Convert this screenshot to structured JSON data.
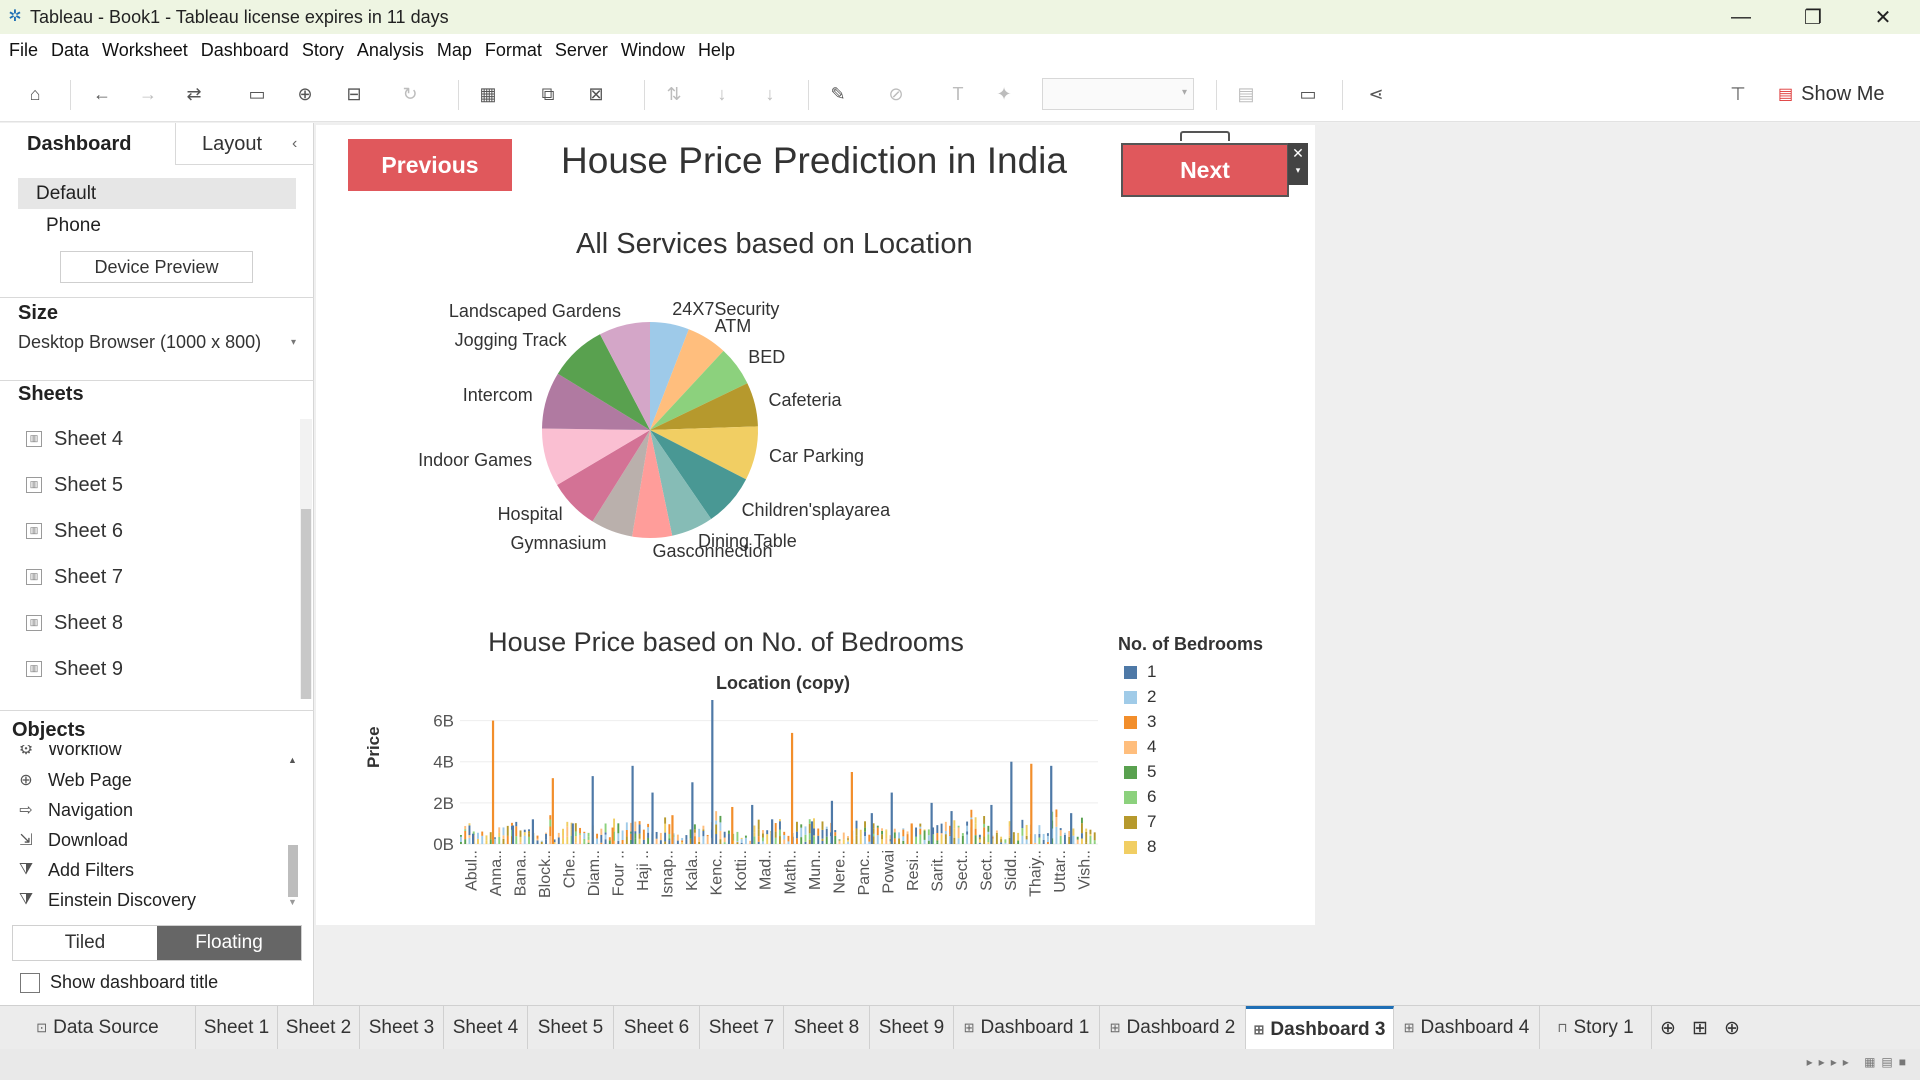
{
  "window": {
    "title": "Tableau - Book1 - Tableau license expires in 11 days",
    "controls": {
      "minimize": "—",
      "maximize": "❐",
      "close": "✕"
    }
  },
  "menu": [
    "File",
    "Data",
    "Worksheet",
    "Dashboard",
    "Story",
    "Analysis",
    "Map",
    "Format",
    "Server",
    "Window",
    "Help"
  ],
  "toolbar": {
    "show_me": "Show Me"
  },
  "left_panel": {
    "tabs": {
      "dashboard": "Dashboard",
      "layout": "Layout"
    },
    "device": {
      "default": "Default",
      "phone": "Phone",
      "preview_button": "Device Preview"
    },
    "size": {
      "title": "Size",
      "value": "Desktop Browser (1000 x 800)"
    },
    "sheets": {
      "title": "Sheets",
      "items": [
        "Sheet 4",
        "Sheet 5",
        "Sheet 6",
        "Sheet 7",
        "Sheet 8",
        "Sheet 9"
      ]
    },
    "objects": {
      "title": "Objects",
      "items": [
        "Workflow",
        "Web Page",
        "Navigation",
        "Download",
        "Add Filters",
        "Einstein Discovery"
      ]
    },
    "layout_mode": {
      "tiled": "Tiled",
      "floating": "Floating"
    },
    "show_title": "Show dashboard title"
  },
  "dashboard": {
    "title": "House Price Prediction in India",
    "prev_button": "Previous",
    "next_button": "Next",
    "next_close": "✕",
    "next_menu": "▾"
  },
  "chart_data": [
    {
      "type": "pie",
      "title": "All Services based on Location",
      "categories": [
        "24X7Security",
        "ATM",
        "BED",
        "Cafeteria",
        "Car Parking",
        "Children'splayarea",
        "Dining Table",
        "Gasconnection",
        "Gymnasium",
        "Hospital",
        "Indoor Games",
        "Intercom",
        "Jogging Track",
        "Landscaped Gardens"
      ],
      "values": [
        5.5,
        5.7,
        5.6,
        6.2,
        7.6,
        7.4,
        5.9,
        5.6,
        5.9,
        7.1,
        8.2,
        8.0,
        8.1,
        7.2
      ],
      "colors": [
        "#9ecae9",
        "#ffbe7d",
        "#8cd17d",
        "#b6992d",
        "#f1ce63",
        "#499894",
        "#86bcb6",
        "#ff9d9a",
        "#bab0ac",
        "#d37295",
        "#fabfd2",
        "#b07aa1",
        "#59a14f",
        "#d4a6c8",
        "#9d7660",
        "#a0785c",
        "#d7b5a6"
      ]
    },
    {
      "type": "bar",
      "title": "House Price based on  No. of Bedrooms",
      "top_label": "Location (copy)",
      "ylabel": "Price",
      "ylim": [
        0,
        7
      ],
      "y_ticks": [
        "6B",
        "4B",
        "2B",
        "0B"
      ],
      "y_tick_values": [
        6,
        4,
        2,
        0
      ],
      "x_tick_labels": [
        "Abul..",
        "Anna..",
        "Bana..",
        "Block..",
        "Che..",
        "Diam..",
        "Four ..",
        "Haji ..",
        "Isnap..",
        "Kala..",
        "Kenc..",
        "Kotti..",
        "Mad..",
        "Math..",
        "Mun..",
        "Nere..",
        "Panc..",
        "Powai",
        "Resi..",
        "Sarit..",
        "Sect..",
        "Sect..",
        "Sidd..",
        "Thaiy..",
        "Uttar..",
        "Vish.."
      ],
      "legend_title": "No. of Bedrooms",
      "series": [
        {
          "name": "1",
          "color": "#4e79a7"
        },
        {
          "name": "2",
          "color": "#a0cbe8"
        },
        {
          "name": "3",
          "color": "#f28e2b"
        },
        {
          "name": "4",
          "color": "#ffbe7d"
        },
        {
          "name": "5",
          "color": "#59a14f"
        },
        {
          "name": "6",
          "color": "#8cd17d"
        },
        {
          "name": "7",
          "color": "#b6992d"
        },
        {
          "name": "8",
          "color": "#f1ce63"
        }
      ],
      "highlight_bars_billions": [
        0.5,
        6.0,
        0.9,
        1.2,
        3.2,
        1.0,
        3.3,
        0.8,
        3.8,
        2.5,
        1.4,
        3.0,
        7.0,
        1.8,
        1.9,
        1.2,
        5.4,
        1.1,
        2.1,
        3.5,
        1.5,
        2.5,
        1.0,
        2.0,
        1.6,
        1.2,
        1.9,
        4.0,
        3.9,
        3.8,
        1.5
      ]
    }
  ],
  "bottom_tabs": [
    "Data Source",
    "Sheet 1",
    "Sheet 2",
    "Sheet 3",
    "Sheet 4",
    "Sheet 5",
    "Sheet 6",
    "Sheet 7",
    "Sheet 8",
    "Sheet 9",
    "Dashboard 1",
    "Dashboard 2",
    "Dashboard 3",
    "Dashboard 4",
    "Story 1"
  ],
  "active_tab": "Dashboard 3"
}
